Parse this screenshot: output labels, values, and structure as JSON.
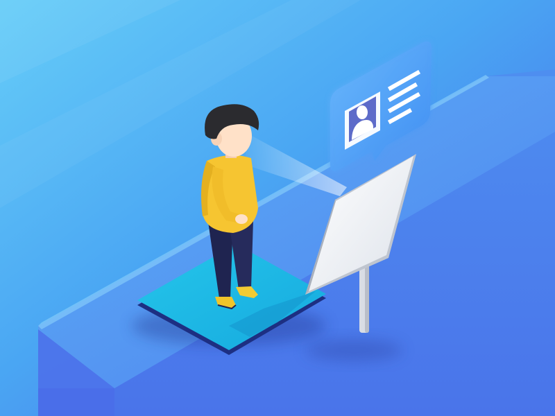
{
  "scene": {
    "subject": "face-recognition-check-in-illustration",
    "colors": {
      "bg_light": "#62c9f7",
      "bg_dark": "#4466ea",
      "platform_top": "#58a6f2",
      "pad_top": "#1fb8e6",
      "pad_edge": "#1d2f82",
      "shirt": "#f6c531",
      "pants": "#1f2450",
      "hair": "#2b2b2f",
      "skin": "#ffe1c8",
      "shoes": "#f0c52a",
      "kiosk_face": "#e9ecf2",
      "kiosk_side": "#c8cdd6",
      "bubble": "#4f9df6"
    },
    "icons": [
      "person-icon",
      "text-lines-icon"
    ]
  }
}
